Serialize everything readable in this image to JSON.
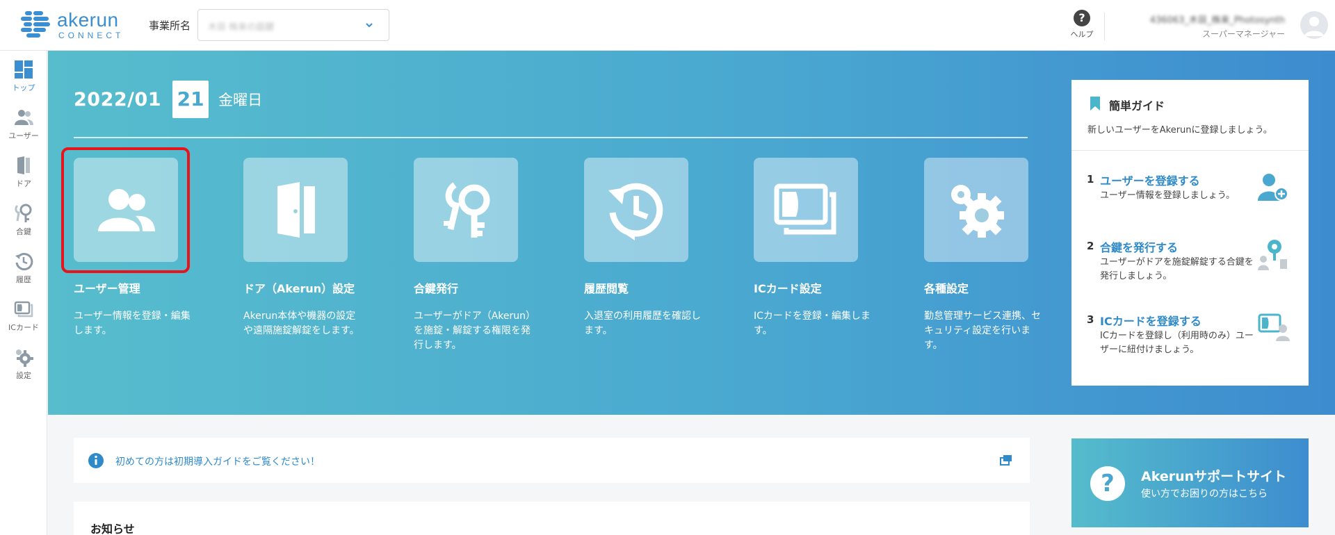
{
  "header": {
    "logo_main": "akerun",
    "logo_sub": "CONNECT",
    "office_label": "事業所名",
    "office_value": "木目 株来の庭鍵",
    "help_label": "ヘルプ",
    "user_name": "436063_木目_株来_Photosynth",
    "user_role": "スーパーマネージャー"
  },
  "sidebar": {
    "items": [
      {
        "label": "トップ",
        "icon": "dashboard-icon",
        "active": true
      },
      {
        "label": "ユーザー",
        "icon": "users-icon",
        "active": false
      },
      {
        "label": "ドア",
        "icon": "door-icon",
        "active": false
      },
      {
        "label": "合鍵",
        "icon": "key-icon",
        "active": false
      },
      {
        "label": "履歴",
        "icon": "history-icon",
        "active": false
      },
      {
        "label": "ICカード",
        "icon": "ic-card-icon",
        "active": false
      },
      {
        "label": "設定",
        "icon": "gear-icon",
        "active": false
      }
    ]
  },
  "hero": {
    "date_ym": "2022/01",
    "date_day": "21",
    "weekday": "金曜日",
    "tiles": [
      {
        "title": "ユーザー管理",
        "desc": "ユーザー情報を登録・編集します。",
        "icon": "users-icon"
      },
      {
        "title": "ドア（Akerun）設定",
        "desc": "Akerun本体や機器の設定や遠隔施錠解錠をします。",
        "icon": "door-icon"
      },
      {
        "title": "合鍵発行",
        "desc": "ユーザーがドア（Akerun）を施錠・解錠する権限を発行します。",
        "icon": "key-icon"
      },
      {
        "title": "履歴閲覧",
        "desc": "入退室の利用履歴を確認します。",
        "icon": "history-icon"
      },
      {
        "title": "ICカード設定",
        "desc": "ICカードを登録・編集します。",
        "icon": "ic-card-icon"
      },
      {
        "title": "各種設定",
        "desc": "勤怠管理サービス連携、セキュリティ設定を行います。",
        "icon": "gear-icon"
      }
    ]
  },
  "guide": {
    "title": "簡単ガイド",
    "subtitle": "新しいユーザーをAkerunに登録しましょう。",
    "steps": [
      {
        "num": "1",
        "title": "ユーザーを登録する",
        "desc": "ユーザー情報を登録しましょう。"
      },
      {
        "num": "2",
        "title": "合鍵を発行する",
        "desc": "ユーザーがドアを施錠解錠する合鍵を発行しましょう。"
      },
      {
        "num": "3",
        "title": "ICカードを登録する",
        "desc": "ICカードを登録し（利用時のみ）ユーザーに紐付けましょう。"
      }
    ]
  },
  "notice": {
    "text": "初めての方は初期導入ガイドをご覧ください！"
  },
  "news": {
    "title": "お知らせ"
  },
  "support": {
    "title": "Akerunサポートサイト",
    "subtitle": "使い方でお困りの方はこちら"
  },
  "colors": {
    "accent": "#3b8ed0",
    "highlight": "#e8141c",
    "hero_start": "#57bdcd",
    "hero_end": "#3d8ccf"
  }
}
